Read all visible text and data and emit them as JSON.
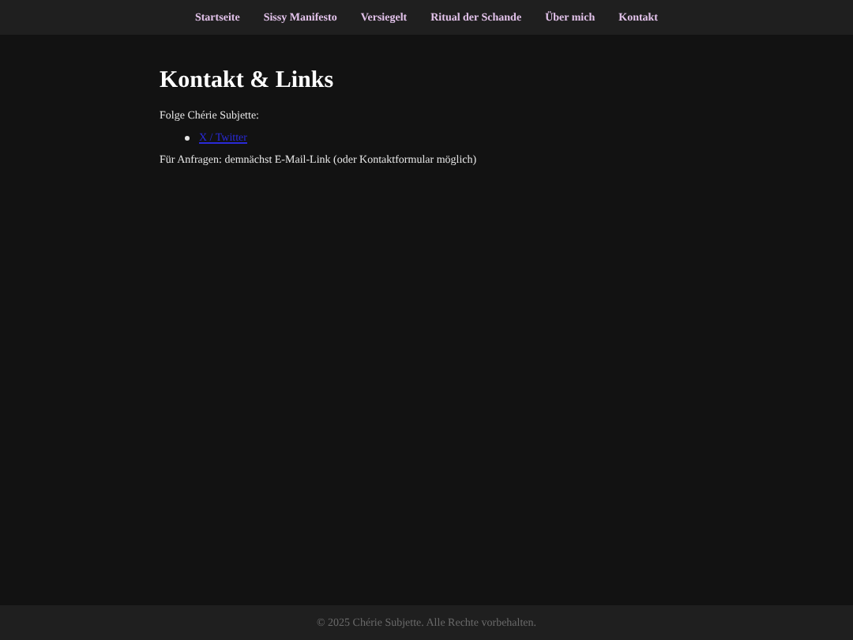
{
  "nav": [
    {
      "label": "Startseite"
    },
    {
      "label": "Sissy Manifesto"
    },
    {
      "label": "Versiegelt"
    },
    {
      "label": "Ritual der Schande"
    },
    {
      "label": "Über mich"
    },
    {
      "label": "Kontakt"
    }
  ],
  "heading": "Kontakt & Links",
  "intro": "Folge Chérie Subjette:",
  "links": [
    "X / Twitter"
  ],
  "note": "Für Anfragen: demnächst E-Mail-Link (oder Kontaktformular möglich)",
  "footer": "© 2025 Chérie Subjette. Alle Rechte vorbehalten."
}
